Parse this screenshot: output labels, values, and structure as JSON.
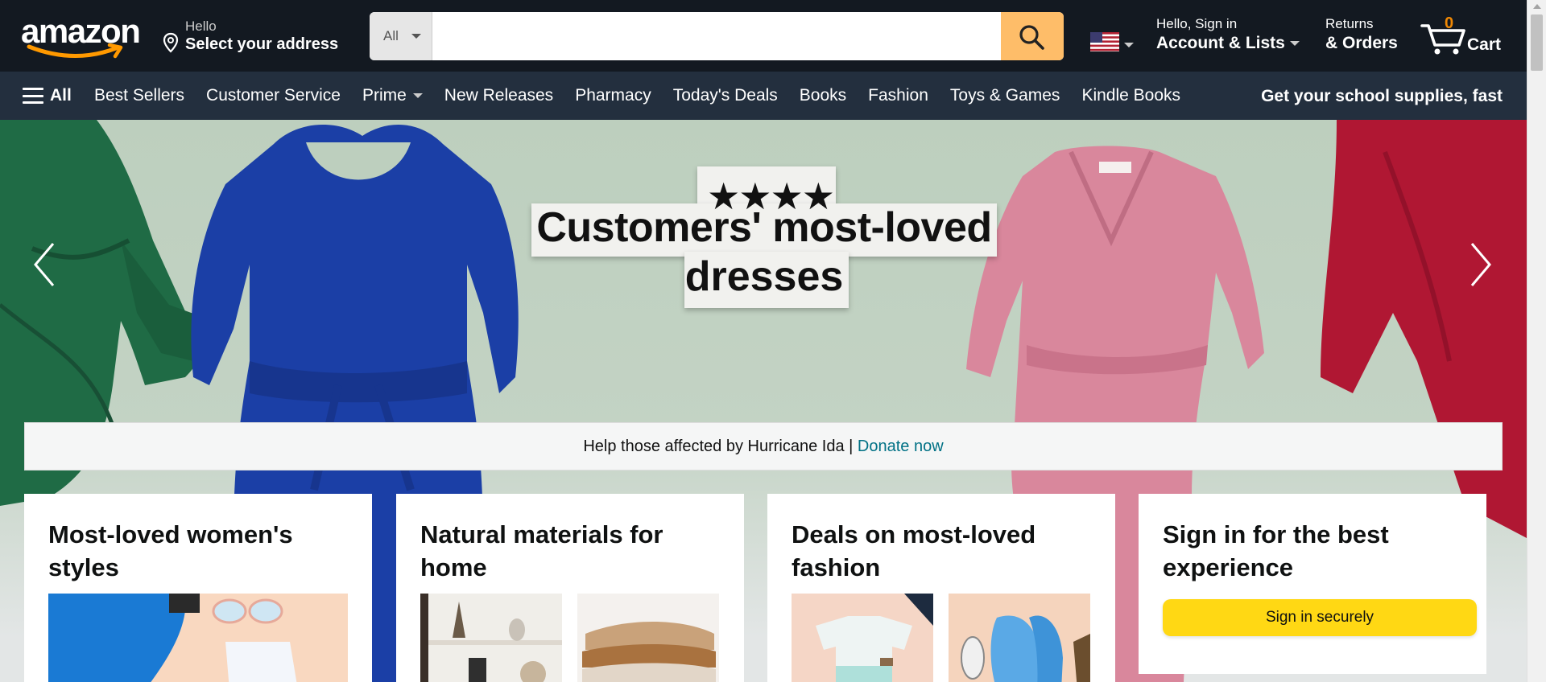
{
  "header": {
    "logo_text": "amazon",
    "address_line1": "Hello",
    "address_line2": "Select your address",
    "search_category": "All",
    "search_placeholder": "",
    "account_line1": "Hello, Sign in",
    "account_line2": "Account & Lists",
    "returns_line1": "Returns",
    "returns_line2": "& Orders",
    "cart_count": "0",
    "cart_label": "Cart",
    "flag_icon": "us-flag-icon"
  },
  "nav": {
    "all_label": "All",
    "items": [
      {
        "label": "Best Sellers",
        "has_caret": false
      },
      {
        "label": "Customer Service",
        "has_caret": false
      },
      {
        "label": "Prime",
        "has_caret": true
      },
      {
        "label": "New Releases",
        "has_caret": false
      },
      {
        "label": "Pharmacy",
        "has_caret": false
      },
      {
        "label": "Today's Deals",
        "has_caret": false
      },
      {
        "label": "Books",
        "has_caret": false
      },
      {
        "label": "Fashion",
        "has_caret": false
      },
      {
        "label": "Toys & Games",
        "has_caret": false
      },
      {
        "label": "Kindle Books",
        "has_caret": false
      }
    ],
    "promo": "Get your school supplies, fast"
  },
  "hero": {
    "stars": "★★★★",
    "title_line1": "Customers' most-loved",
    "title_line2": "dresses"
  },
  "donate": {
    "text": "Help those affected by Hurricane Ida | ",
    "link": "Donate now"
  },
  "cards": [
    {
      "title": "Most-loved women's styles"
    },
    {
      "title": "Natural materials for home"
    },
    {
      "title": "Deals on most-loved fashion"
    },
    {
      "title": "Sign in for the best experience",
      "button": "Sign in securely"
    }
  ],
  "colors": {
    "header_bg": "#131921",
    "nav_bg": "#232f3e",
    "search_button": "#febd69",
    "cart_count": "#f08804",
    "signin_button": "#ffd814",
    "link": "#007185"
  }
}
